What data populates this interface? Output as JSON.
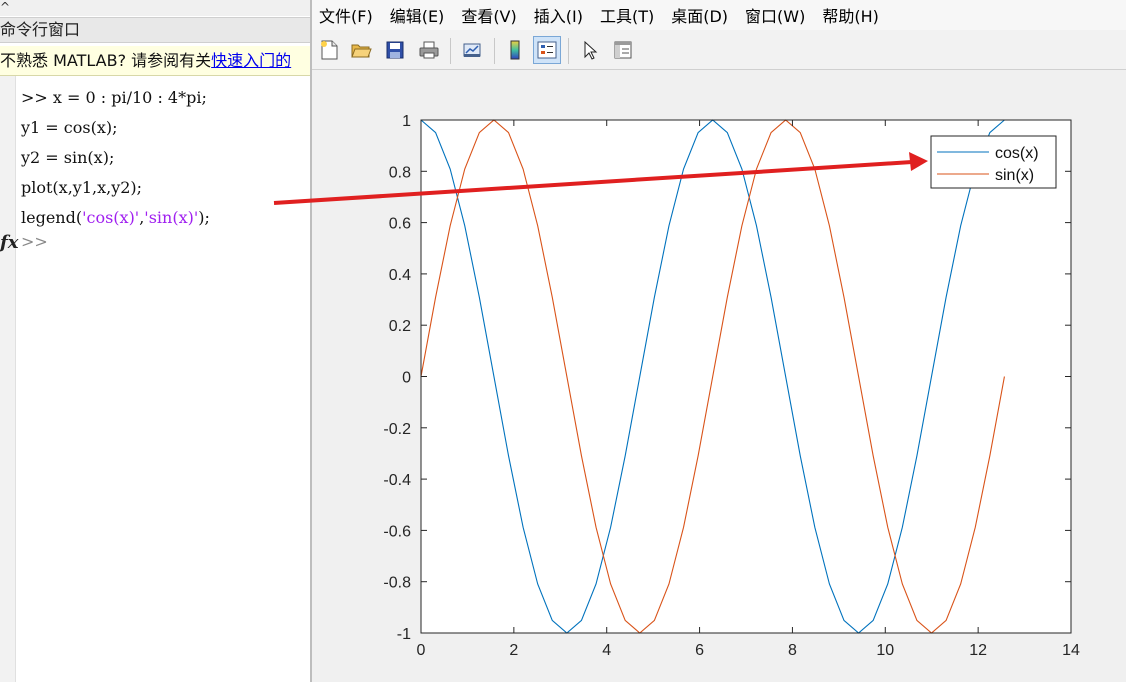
{
  "command_window": {
    "top_tick": "^",
    "title": "命令行窗口",
    "hint_text": "不熟悉 MATLAB? 请参阅有关",
    "hint_link": "快速入门的",
    "lines": [
      {
        "prompt": ">> ",
        "code": "x = 0 : pi/10 : 4*pi;"
      },
      {
        "prompt": "",
        "code": "y1 = cos(x);"
      },
      {
        "prompt": "",
        "code": "y2 = sin(x);"
      },
      {
        "prompt": "",
        "code": "plot(x,y1,x,y2);"
      },
      {
        "prompt": "",
        "code_pre": "legend(",
        "str1": "'cos(x)'",
        "code_mid": ",",
        "str2": "'sin(x)'",
        "code_post": ");"
      }
    ],
    "fx_label": "fx",
    "empty_prompt": ">>"
  },
  "figure": {
    "menu": [
      "文件(F)",
      "编辑(E)",
      "查看(V)",
      "插入(I)",
      "工具(T)",
      "桌面(D)",
      "窗口(W)",
      "帮助(H)"
    ],
    "toolbar_icons": [
      "new-figure-icon",
      "open-file-icon",
      "save-icon",
      "print-icon",
      "link-plot-icon",
      "colorbar-icon",
      "legend-icon",
      "edit-plot-icon",
      "property-inspector-icon"
    ]
  },
  "colors": {
    "series1": "#0072bd",
    "series2": "#d95319",
    "arrow": "#e02020",
    "string": "#a020f0"
  },
  "chart_data": {
    "type": "line",
    "x_expression": "0 : pi/10 : 4*pi",
    "series": [
      {
        "name": "cos(x)",
        "function": "cos",
        "color": "#0072bd"
      },
      {
        "name": "sin(x)",
        "function": "sin",
        "color": "#d95319"
      }
    ],
    "xlim": [
      0,
      14
    ],
    "ylim": [
      -1,
      1
    ],
    "xticks": [
      0,
      2,
      4,
      6,
      8,
      10,
      12,
      14
    ],
    "yticks": [
      1,
      0.8,
      0.6,
      0.4,
      0.2,
      0,
      -0.2,
      -0.4,
      -0.6,
      -0.8,
      -1
    ],
    "xtick_labels": [
      "0",
      "2",
      "4",
      "6",
      "8",
      "10",
      "12",
      "14"
    ],
    "ytick_labels": [
      "1",
      "0.8",
      "0.6",
      "0.4",
      "0.2",
      "0",
      "-0.2",
      "-0.4",
      "-0.6",
      "-0.8",
      "-1"
    ],
    "legend": [
      "cos(x)",
      "sin(x)"
    ],
    "legend_location": "northeast",
    "grid": false
  }
}
